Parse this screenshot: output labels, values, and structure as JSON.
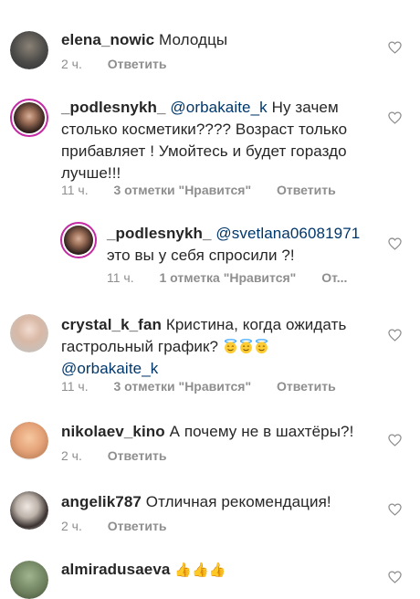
{
  "icons": {
    "like": "heart-outline-icon"
  },
  "colors": {
    "mention": "#00376b",
    "meta": "#8e8e8e",
    "story_ring": "#c32aa3"
  },
  "comments": [
    {
      "user": "elena_nowic",
      "text": "Молодцы",
      "time": "2 ч.",
      "reply": "Ответить"
    },
    {
      "user": "_podlesnykh_",
      "mention": "@orbakaite_k",
      "text_line1": "Ну зачем",
      "text_line2": "столько косметики???? Возраст только",
      "text_line3": "прибавляет ! Умойтесь и будет гораздо",
      "text_line4": "лучше!!!",
      "time": "11 ч.",
      "likes": "3 отметки \"Нравится\"",
      "reply": "Ответить"
    },
    {
      "user": "_podlesnykh_",
      "mention": "@svetlana06081971",
      "text": "это вы у себя спросили ?!",
      "time": "11 ч.",
      "likes": "1 отметка \"Нравится\"",
      "reply": "От..."
    },
    {
      "user": "crystal_k_fan",
      "text_line1": "Кристина, когда ожидать",
      "text_line2": "гастрольный график?",
      "mention": "@orbakaite_k",
      "time": "11 ч.",
      "likes": "3 отметки \"Нравится\"",
      "reply": "Ответить"
    },
    {
      "user": "nikolaev_kino",
      "text": "А почему не в шахтёры?!",
      "time": "2 ч.",
      "reply": "Ответить"
    },
    {
      "user": "angelik787",
      "text": "Отличная рекомендация!",
      "time": "2 ч.",
      "reply": "Ответить"
    },
    {
      "user": "almiradusaeva"
    }
  ]
}
